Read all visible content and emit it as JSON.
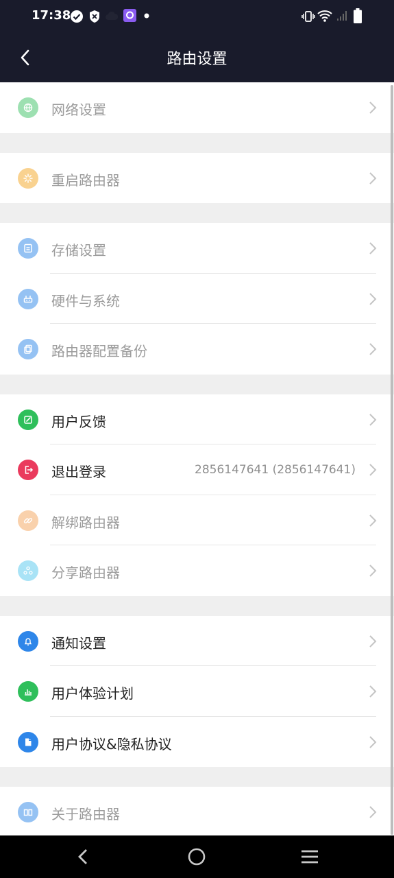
{
  "status_bar": {
    "time": "17:38"
  },
  "header": {
    "title": "路由设置"
  },
  "groups": [
    [
      {
        "label": "网络设置",
        "icon": "globe-icon",
        "color": "#3ec266",
        "disabled": true
      }
    ],
    [
      {
        "label": "重启路由器",
        "icon": "restart-icon",
        "color": "#f5a623",
        "disabled": true
      }
    ],
    [
      {
        "label": "存储设置",
        "icon": "storage-icon",
        "color": "#2e86e9",
        "disabled": true
      },
      {
        "label": "硬件与系统",
        "icon": "router-icon",
        "color": "#2e86e9",
        "disabled": true
      },
      {
        "label": "路由器配置备份",
        "icon": "backup-icon",
        "color": "#2e86e9",
        "disabled": true
      }
    ],
    [
      {
        "label": "用户反馈",
        "icon": "edit-icon",
        "color": "#2fbf5b",
        "disabled": false
      },
      {
        "label": "退出登录",
        "icon": "logout-icon",
        "color": "#ea3a5d",
        "disabled": false,
        "value": "2856147641 (2856147641)"
      },
      {
        "label": "解绑路由器",
        "icon": "link-icon",
        "color": "#f5a45c",
        "disabled": true
      },
      {
        "label": "分享路由器",
        "icon": "share-icon",
        "color": "#55c8ee",
        "disabled": true
      }
    ],
    [
      {
        "label": "通知设置",
        "icon": "bell-icon",
        "color": "#2e86e9",
        "disabled": false
      },
      {
        "label": "用户体验计划",
        "icon": "chart-icon",
        "color": "#2fbf5b",
        "disabled": false
      },
      {
        "label": "用户协议&隐私协议",
        "icon": "document-icon",
        "color": "#2e86e9",
        "disabled": false
      }
    ],
    [
      {
        "label": "关于路由器",
        "icon": "book-icon",
        "color": "#2e86e9",
        "disabled": true
      }
    ]
  ]
}
